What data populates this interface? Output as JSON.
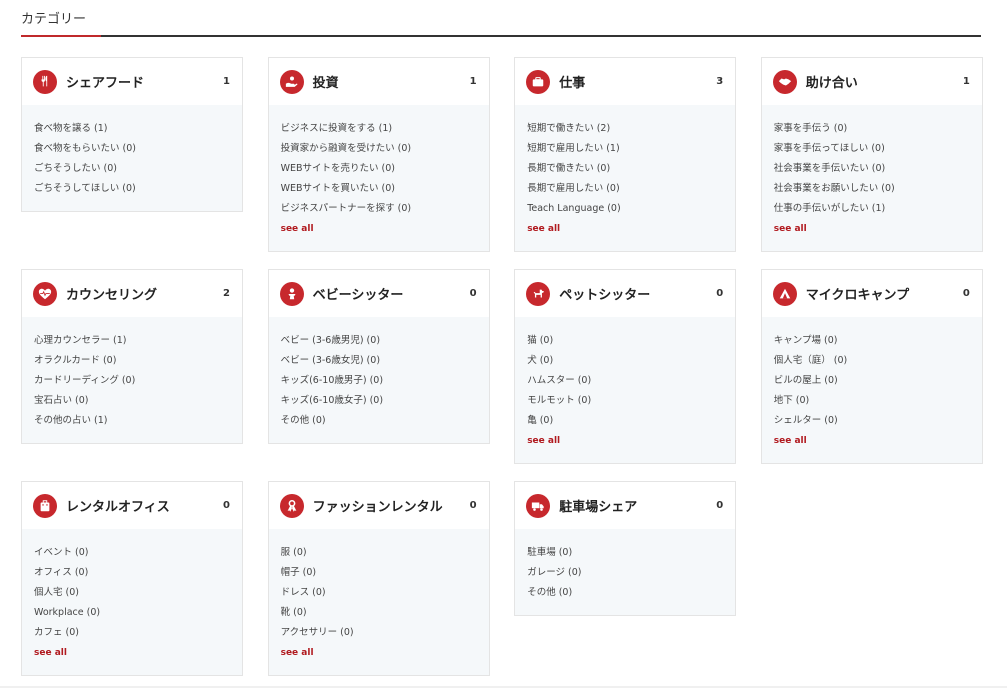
{
  "header": {
    "title": "カテゴリー"
  },
  "categories": [
    {
      "name": "シェアフード",
      "count": "1",
      "icon": "utensils-icon",
      "items": [
        "食べ物を譲る (1)",
        "食べ物をもらいたい (0)",
        "ごちそうしたい (0)",
        "ごちそうしてほしい (0)"
      ],
      "see_all": ""
    },
    {
      "name": "投資",
      "count": "1",
      "icon": "hand-coin-icon",
      "items": [
        "ビジネスに投資をする (1)",
        "投資家から融資を受けたい (0)",
        "WEBサイトを売りたい (0)",
        "WEBサイトを買いたい (0)",
        "ビジネスパートナーを探す (0)"
      ],
      "see_all": "see all"
    },
    {
      "name": "仕事",
      "count": "3",
      "icon": "briefcase-icon",
      "items": [
        "短期で働きたい (2)",
        "短期で雇用したい (1)",
        "長期で働きたい (0)",
        "長期で雇用したい (0)",
        "Teach Language (0)"
      ],
      "see_all": "see all"
    },
    {
      "name": "助け合い",
      "count": "1",
      "icon": "handshake-icon",
      "items": [
        "家事を手伝う (0)",
        "家事を手伝ってほしい (0)",
        "社会事業を手伝いたい (0)",
        "社会事業をお願いしたい (0)",
        "仕事の手伝いがしたい (1)"
      ],
      "see_all": "see all"
    },
    {
      "name": "カウンセリング",
      "count": "2",
      "icon": "heartbeat-icon",
      "items": [
        "心理カウンセラー (1)",
        "オラクルカード (0)",
        "カードリーディング (0)",
        "宝石占い (0)",
        "その他の占い (1)"
      ],
      "see_all": ""
    },
    {
      "name": "ベビーシッター",
      "count": "0",
      "icon": "baby-icon",
      "items": [
        "ベビー (3-6歳男児) (0)",
        "ベビー (3-6歳女児) (0)",
        "キッズ(6-10歳男子) (0)",
        "キッズ(6-10歳女子) (0)",
        "その他 (0)"
      ],
      "see_all": ""
    },
    {
      "name": "ペットシッター",
      "count": "0",
      "icon": "dog-icon",
      "items": [
        "猫 (0)",
        "犬 (0)",
        "ハムスター (0)",
        "モルモット (0)",
        "亀 (0)"
      ],
      "see_all": "see all"
    },
    {
      "name": "マイクロキャンプ",
      "count": "0",
      "icon": "campfire-icon",
      "items": [
        "キャンプ場 (0)",
        "個人宅（庭） (0)",
        "ビルの屋上 (0)",
        "地下 (0)",
        "シェルター (0)"
      ],
      "see_all": "see all"
    },
    {
      "name": "レンタルオフィス",
      "count": "0",
      "icon": "building-icon",
      "items": [
        "イベント (0)",
        "オフィス (0)",
        "個人宅 (0)",
        "Workplace (0)",
        "カフェ (0)"
      ],
      "see_all": "see all"
    },
    {
      "name": "ファッションレンタル",
      "count": "0",
      "icon": "ribbon-icon",
      "items": [
        "服 (0)",
        "帽子 (0)",
        "ドレス (0)",
        "靴 (0)",
        "アクセサリー (0)"
      ],
      "see_all": "see all"
    },
    {
      "name": "駐車場シェア",
      "count": "0",
      "icon": "truck-icon",
      "items": [
        "駐車場 (0)",
        "ガレージ (0)",
        "その他 (0)"
      ],
      "see_all": ""
    }
  ],
  "colors": {
    "accent": "#c7282d",
    "link": "#b11a1f",
    "body_bg": "#f5f8fa"
  }
}
